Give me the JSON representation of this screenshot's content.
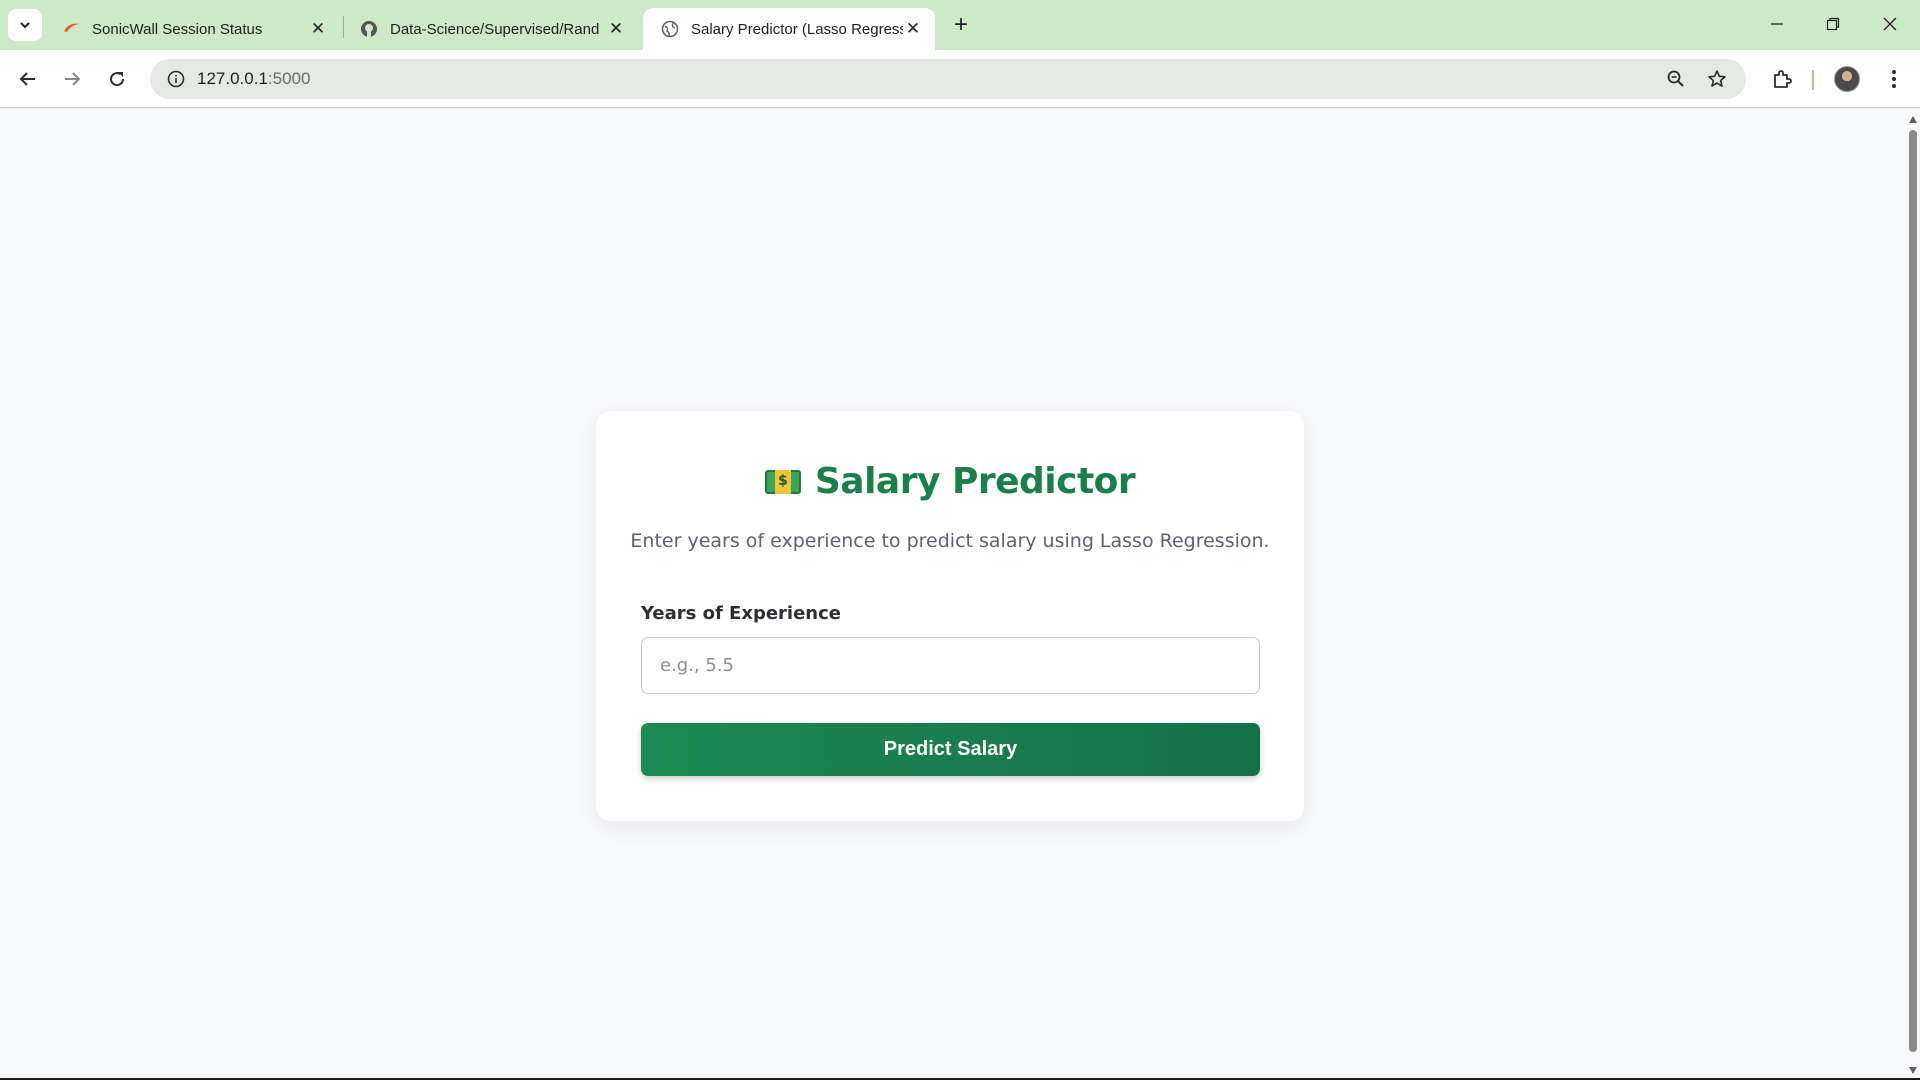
{
  "browser": {
    "tabs": [
      {
        "title": "SonicWall Session Status",
        "favicon": "sonicwall-swoosh-icon",
        "active": false
      },
      {
        "title": "Data-Science/Supervised/Rand",
        "favicon": "github-icon",
        "active": false
      },
      {
        "title": "Salary Predictor (Lasso Regressi",
        "favicon": "globe-icon",
        "active": true
      }
    ],
    "new_tab_label": "+",
    "close_label": "✕",
    "url_host": "127.0.0.1",
    "url_rest": ":5000"
  },
  "page": {
    "title": "Salary Predictor",
    "title_icon": "money-bill-icon",
    "subtitle": "Enter years of experience to predict salary using Lasso Regression.",
    "field_label": "Years of Experience",
    "field_placeholder": "e.g., 5.5",
    "field_value": "",
    "button_label": "Predict Salary",
    "accent_color": "#1a7f4b"
  }
}
